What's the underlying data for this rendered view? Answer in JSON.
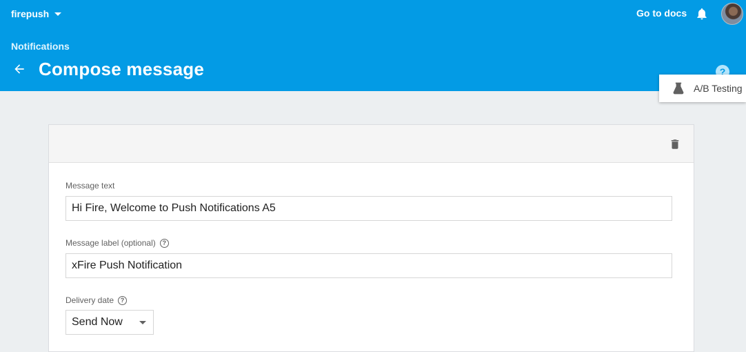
{
  "header": {
    "project": "firepush",
    "docs_link": "Go to docs",
    "breadcrumb": "Notifications",
    "title": "Compose message",
    "help": "?"
  },
  "ab_testing": {
    "label": "A/B Testing"
  },
  "form": {
    "message_text": {
      "label": "Message text",
      "value": "Hi Fire, Welcome to Push Notifications A5"
    },
    "message_label": {
      "label": "Message label (optional)",
      "value": "xFire Push Notification"
    },
    "delivery_date": {
      "label": "Delivery date",
      "value": "Send Now"
    }
  },
  "colors": {
    "header": "#039be5",
    "background": "#eceff1"
  },
  "icons": [
    "chevron-down-icon",
    "bell-icon",
    "avatar",
    "back-arrow-icon",
    "help-icon",
    "flask-icon",
    "trash-icon"
  ]
}
